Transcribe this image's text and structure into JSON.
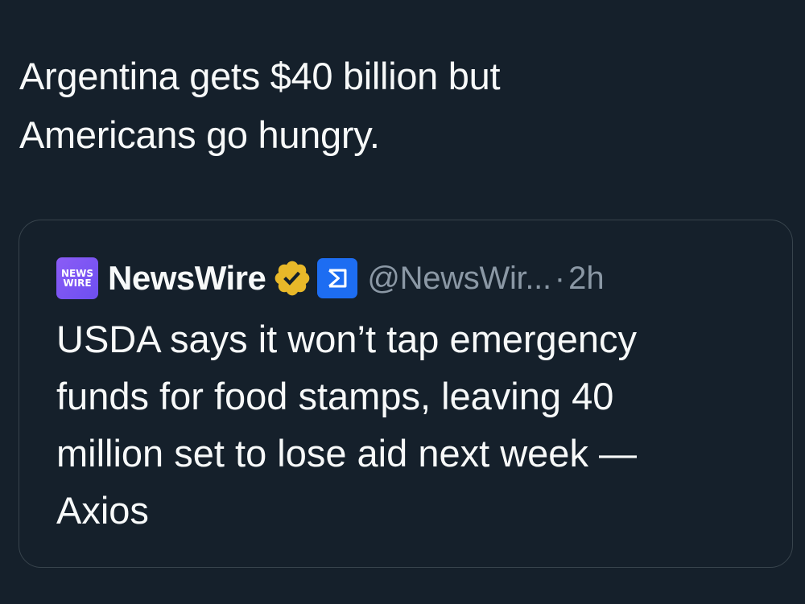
{
  "post": {
    "text_lines": [
      "Argentina gets $40 billion but",
      "Americans go hungry."
    ]
  },
  "quoted_post": {
    "avatar_text_line1": "NEWS",
    "avatar_text_line2": "WIRE",
    "avatar_colors": [
      "#8b5cf6",
      "#6d4ff0"
    ],
    "display_name": "NewsWire",
    "verified_icon": "verified-badge-gold-icon",
    "affiliate_icon": "affiliate-badge-icon",
    "handle": "@NewsWir...",
    "separator": "·",
    "time": "2h",
    "text_lines": [
      "USDA says it won’t tap emergency",
      "funds for food stamps, leaving 40",
      "million set to lose aid next week —",
      "Axios"
    ]
  },
  "colors": {
    "background": "#15202b",
    "text": "#f7f9f9",
    "secondary_text": "#8b98a5",
    "border": "#38444d",
    "verified_gold": "#e8b829",
    "affiliate_blue": "#1d6df2"
  }
}
